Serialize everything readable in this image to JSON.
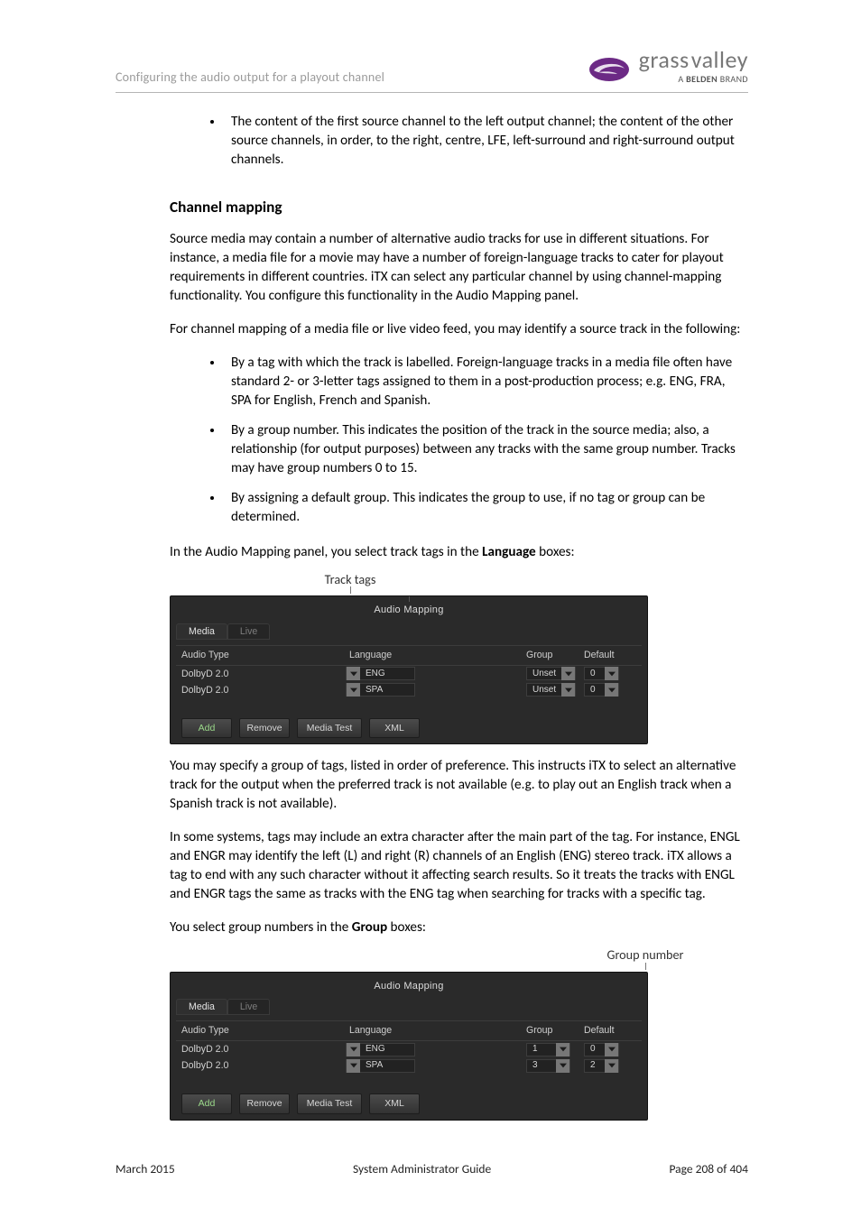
{
  "header": {
    "left": "Configuring the audio output for a playout channel"
  },
  "logo": {
    "brand_a": "grass",
    "brand_b": "valley",
    "tagline_a": "A ",
    "tagline_b": "BELDEN",
    "tagline_c": " BRAND"
  },
  "intro_bullet": {
    "text": "The content of the first source channel to the left output channel; the content of the other source channels, in order, to the right, centre, LFE, left-surround and right-surround output channels."
  },
  "section": {
    "title": "Channel mapping"
  },
  "paras": {
    "p1": "Source media may contain a number of alternative audio tracks for use in different situations. For instance, a media file for a movie may have a number of foreign-language tracks to cater for playout requirements in different countries. iTX can select any particular channel by using channel-mapping functionality. You configure this functionality in the Audio Mapping panel.",
    "p2": "For channel mapping of a media file or live video feed, you may identify a source track in the following:",
    "b1": "By a tag with which the track is labelled. Foreign-language tracks in a media file often have standard 2- or 3-letter tags assigned to them in a post-production process; e.g. ENG, FRA, SPA for English, French and Spanish.",
    "b2": "By a group number. This indicates the position of the track in the source media; also, a relationship (for output purposes) between any tracks with the same group number. Tracks may have group numbers 0 to 15.",
    "b3": "By assigning a default group. This indicates the group to use, if no tag or group can be determined.",
    "p3a": "In the Audio Mapping panel, you select track tags in the ",
    "p3b": "Language",
    "p3c": " boxes:",
    "p4": "You may specify a group of tags, listed in order of preference. This instructs iTX to select an alternative track for the output when the preferred track is not available (e.g. to play out an English track when a Spanish track is not available).",
    "p5": "In some systems, tags may include an extra character after the main part of the tag. For instance, ENGL and ENGR may identify the left (L) and right (R) channels of an English (ENG) stereo track. iTX allows a tag to end with any such character without it affecting search results. So it treats the tracks with ENGL and ENGR tags the same as tracks with the ENG tag when searching for tracks with a specific tag.",
    "p6a": "You select group numbers in the ",
    "p6b": "Group",
    "p6c": " boxes:"
  },
  "callouts": {
    "track": "Track tags",
    "group": "Group number"
  },
  "panel": {
    "title": "Audio Mapping",
    "tabs": {
      "media": "Media",
      "live": "Live"
    },
    "cols": {
      "type": "Audio Type",
      "lang": "Language",
      "group": "Group",
      "def": "Default"
    },
    "btns": {
      "add": "Add",
      "remove": "Remove",
      "mtest": "Media Test",
      "xml": "XML"
    }
  },
  "panel1_rows": [
    {
      "type": "DolbyD 2.0",
      "lang": "ENG",
      "group": "Unset",
      "def": "0"
    },
    {
      "type": "DolbyD 2.0",
      "lang": "SPA",
      "group": "Unset",
      "def": "0"
    }
  ],
  "panel2_rows": [
    {
      "type": "DolbyD 2.0",
      "lang": "ENG",
      "group": "1",
      "def": "0"
    },
    {
      "type": "DolbyD 2.0",
      "lang": "SPA",
      "group": "3",
      "def": "2"
    }
  ],
  "footer": {
    "left": "March 2015",
    "center": "System Administrator Guide",
    "right": "Page 208 of 404"
  }
}
